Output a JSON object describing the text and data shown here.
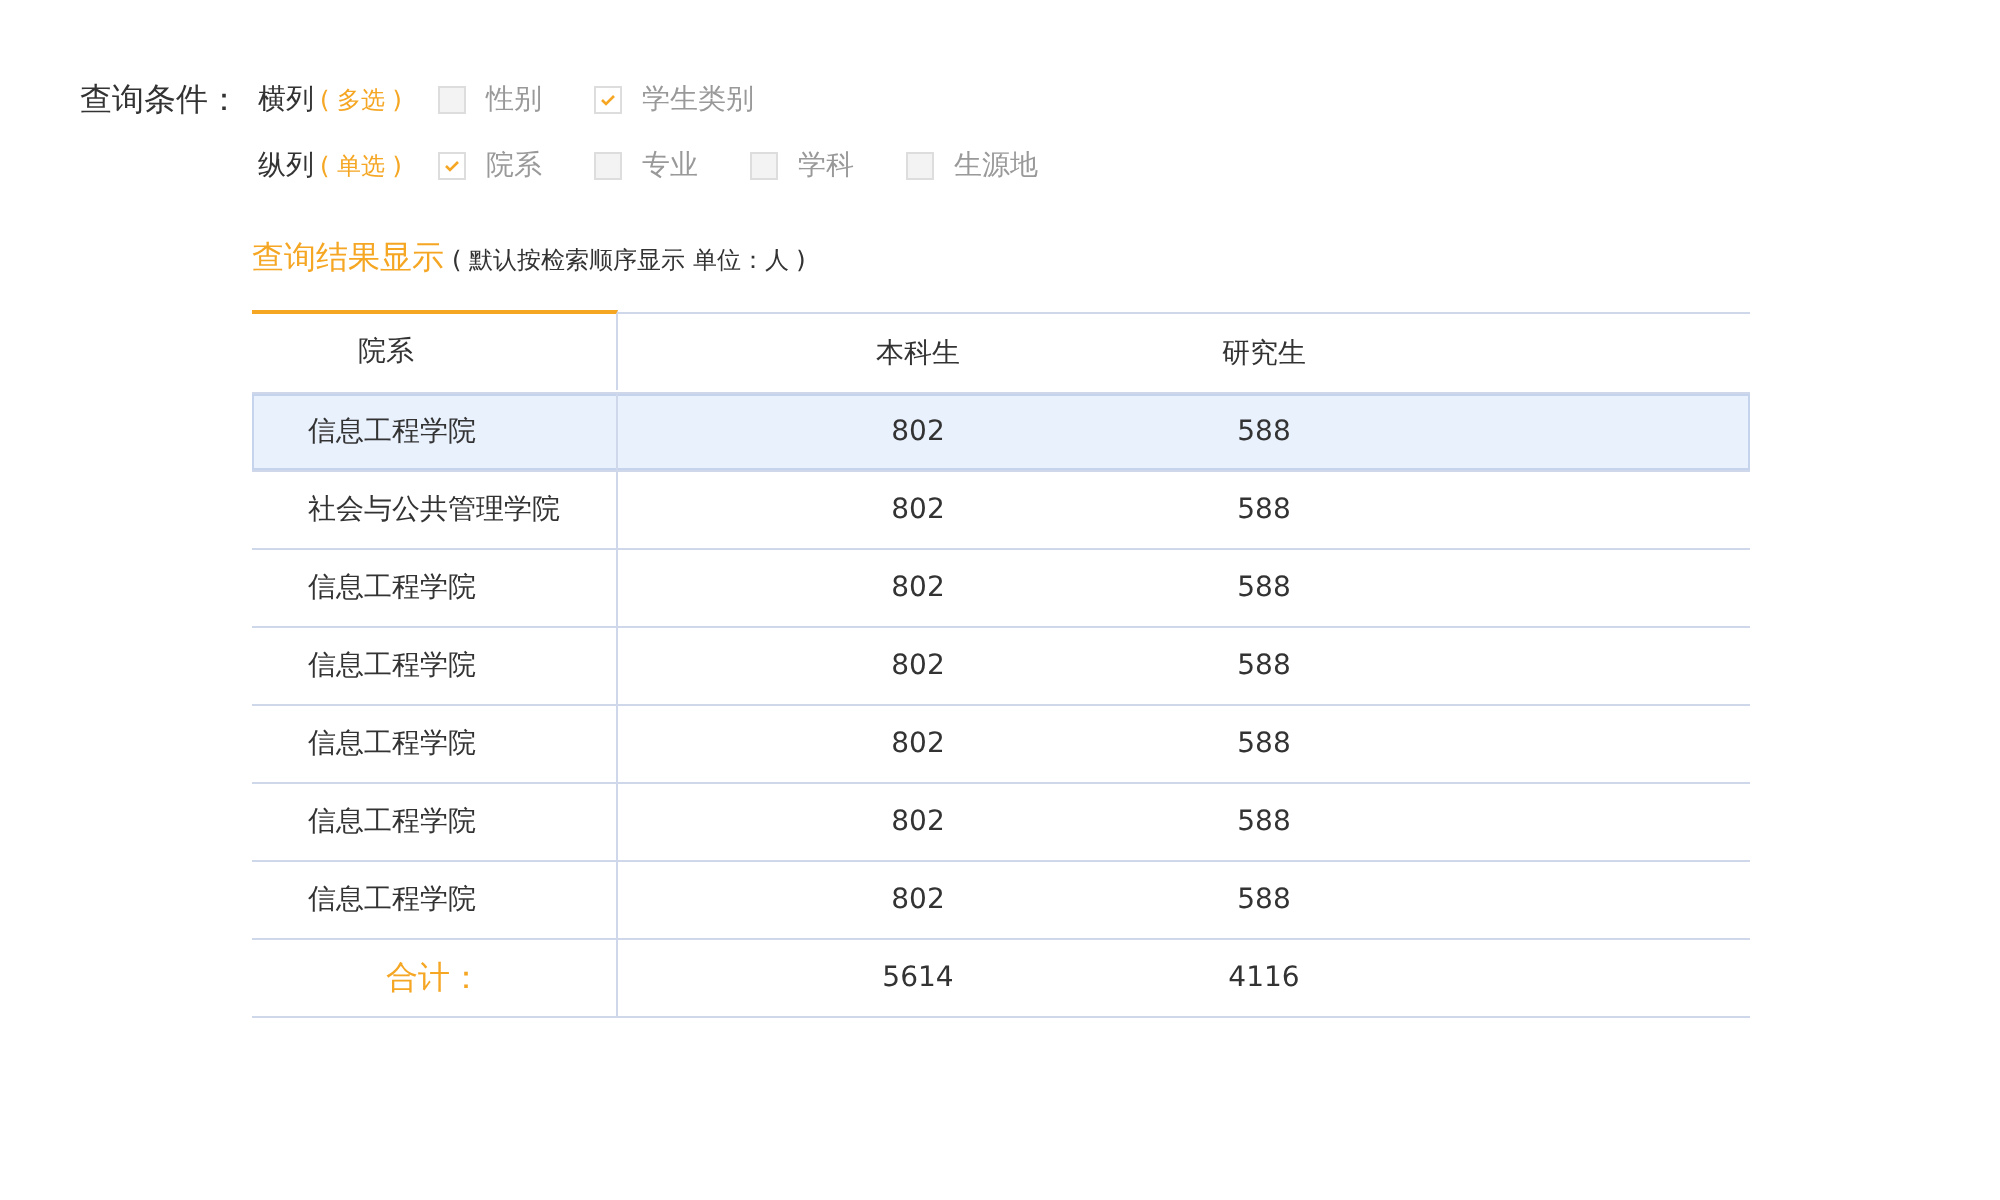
{
  "query_label": "查询条件：",
  "filters": [
    {
      "label": "横列",
      "hint": "( 多选 )",
      "options": [
        {
          "label": "性别",
          "checked": false
        },
        {
          "label": "学生类别",
          "checked": true
        }
      ]
    },
    {
      "label": "纵列",
      "hint": "( 单选 )",
      "options": [
        {
          "label": "院系",
          "checked": true
        },
        {
          "label": "专业",
          "checked": false
        },
        {
          "label": "学科",
          "checked": false
        },
        {
          "label": "生源地",
          "checked": false
        }
      ]
    }
  ],
  "result": {
    "title": "查询结果显示",
    "note": "( 默认按检索顺序显示 单位：人 )"
  },
  "table": {
    "columns": [
      "院系",
      "本科生",
      "研究生"
    ],
    "rows": [
      {
        "cells": [
          "信息工程学院",
          "802",
          "588"
        ],
        "selected": true
      },
      {
        "cells": [
          "社会与公共管理学院",
          "802",
          "588"
        ],
        "selected": false
      },
      {
        "cells": [
          "信息工程学院",
          "802",
          "588"
        ],
        "selected": false
      },
      {
        "cells": [
          "信息工程学院",
          "802",
          "588"
        ],
        "selected": false
      },
      {
        "cells": [
          "信息工程学院",
          "802",
          "588"
        ],
        "selected": false
      },
      {
        "cells": [
          "信息工程学院",
          "802",
          "588"
        ],
        "selected": false
      },
      {
        "cells": [
          "信息工程学院",
          "802",
          "588"
        ],
        "selected": false
      }
    ],
    "total": {
      "label": "合计：",
      "values": [
        "5614",
        "4116"
      ]
    }
  }
}
